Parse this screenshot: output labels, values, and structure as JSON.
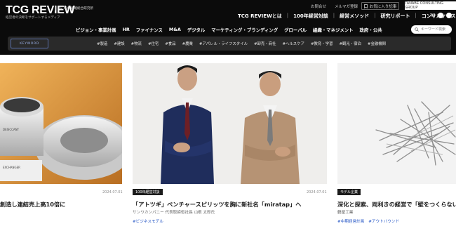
{
  "header": {
    "logo_text": "TCG REVIEW",
    "logo_badge": "by TCG 戦略総合研究所",
    "tagline": "経営者の決断をサポートするメディア",
    "util_links": [
      "お問合せ",
      "メルマガ登録"
    ],
    "fav_label": "お気に入り記事",
    "company_label": "TANABE CONSULTING GROUP",
    "top_nav": [
      "TCG REVIEWとは",
      "100年経営対談",
      "経営メソッド",
      "研究リポート",
      "コンサルケース"
    ],
    "categories": [
      "ビジョン・事業計画",
      "HR",
      "ファイナンス",
      "M&A",
      "デジタル",
      "マーケティング・ブランディング",
      "グローバル",
      "組織・マネジメント",
      "政府・公共"
    ],
    "search_placeholder": "キーワード検索",
    "keyword_label": "KEYWORD",
    "keywords": [
      "#製造",
      "#建設",
      "#物流",
      "#住宅",
      "#食品",
      "#農業",
      "#アパレル・ライフスタイル",
      "#卸売・商社",
      "#ヘルスケア",
      "#教育・学習",
      "#観光・宿泊",
      "#金融機関"
    ]
  },
  "articles": [
    {
      "date": "2024.07.01",
      "badge": "",
      "title": "創造し連結売上高10倍に",
      "subtitle": "",
      "tags": []
    },
    {
      "date": "2024.07.01",
      "badge": "100年経営対談",
      "title": "「アトツギ」ベンチャースピリッツを胸に新社名「miratap」へ",
      "subtitle": "サンワカンパニー 代表取締役社長 山根 太郎氏",
      "tags": [
        "#ビジネスモデル"
      ]
    },
    {
      "date": "",
      "badge": "モデル企業",
      "title": "深化と探索、両利きの経営で「壁をつくらない」未",
      "subtitle": "鶴屋工業",
      "tags": [
        "#中期経営計画",
        "#アウトバウンド"
      ]
    }
  ],
  "colors": {
    "header_bg": "#0b0b0b",
    "tag_blue": "#2c5bc7",
    "badge_bg": "#1b1b1b"
  }
}
